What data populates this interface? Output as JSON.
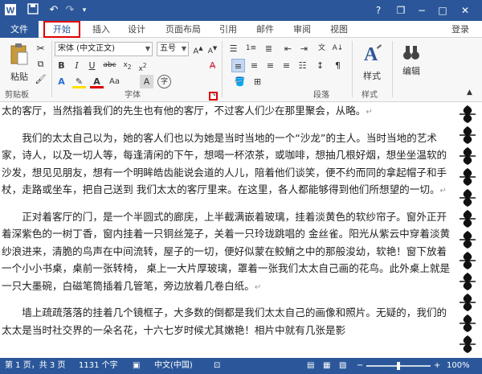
{
  "titlebar": {
    "icons": {
      "app": "word-icon",
      "save": "save-icon",
      "undo": "undo-icon",
      "redo": "redo-icon"
    },
    "controls": {
      "help": "?",
      "restore": "❐",
      "minimize": "−",
      "maximize": "□",
      "close": "✕"
    }
  },
  "tabs": [
    {
      "label": "文件"
    },
    {
      "label": "开始"
    },
    {
      "label": "插入"
    },
    {
      "label": "设计"
    },
    {
      "label": "页面布局"
    },
    {
      "label": "引用"
    },
    {
      "label": "邮件"
    },
    {
      "label": "审阅"
    },
    {
      "label": "视图"
    }
  ],
  "login_label": "登录",
  "ribbon": {
    "paste_label": "粘贴",
    "font_name": "宋体 (中文正文)",
    "font_size": "五号",
    "style_label": "样式",
    "edit_label": "编辑",
    "groups": {
      "clipboard": "剪贴板",
      "font": "字体",
      "paragraph": "段落",
      "styles": "样式"
    }
  },
  "document": {
    "paragraphs": [
      "太的客厅，当然指着我们的先生也有他的客厅，不过客人们少在那里聚会，从略。",
      "我们的太太自己以为，她的客人们也以为她是当时当地的一个“沙龙”的主人。当时当地的艺术家，诗人，以及一切人等，每逢清闲的下午，想喝一杯浓茶，或咖啡，想抽几根好烟，想坐坐温软的沙发，想见见朋友，想有一个明眸皓齿能说会道的人儿，陪着他们谈笑，便不约而同的拿起帽子和手杖，走路或坐车，把自己送到 我们太太的客厅里来。在这里，各人都能够得到他们所想望的一切。",
      "正对着客厅的门，是一个半圆式的廊庑，上半截满嵌着玻璃，挂着淡黄色的软纱帘子。窗外正开着深紫色的一树丁香，窗内挂着一只铜丝笼子，关着一只玲珑跳唱的 金丝雀。阳光从紫云中穿着淡黄纱浪进来，清脆的鸟声在中间流转，屋子的一切，便好似蒙在鲛鮹之中的那般浚幼，软艳！窗下放着一个小小书桌，桌前一张转椅， 桌上一大片厚玻璃，罩着一张我们太太自己画的花鸟。此外桌上就是一只大墨碗，白磁笔筒插着几管笔，旁边放着几卷白纸。",
      "墙上疏疏落落的挂着几个镜框子，大多数的倒都是我们太太自己的画像和照片。无疑的，我们的太太是当时社交界的一朵名花，十六七岁时候尤其嫩艳！相片中就有几张是影"
    ]
  },
  "statusbar": {
    "page": "第 1 页，共 3 页",
    "words": "1131 个字",
    "language": "中文(中国)",
    "zoom": "100%",
    "zoom_minus": "−",
    "zoom_plus": "+"
  }
}
